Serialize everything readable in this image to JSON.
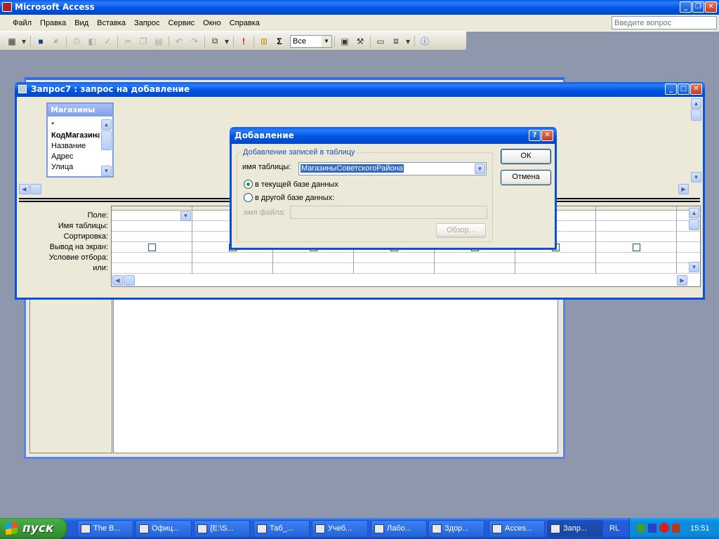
{
  "app": {
    "title": "Microsoft Access",
    "menu": [
      "Файл",
      "Правка",
      "Вид",
      "Вставка",
      "Запрос",
      "Сервис",
      "Окно",
      "Справка"
    ],
    "help_search_placeholder": "Введите вопрос",
    "toolbar_combo_value": "Все"
  },
  "query_window": {
    "title": "Запрос7 : запрос на добавление",
    "table": {
      "name": "Магазины",
      "fields": [
        "*",
        "КодМагазина",
        "Название",
        "Адрес",
        "Улица"
      ]
    },
    "grid_labels": [
      "Поле:",
      "Имя таблицы:",
      "Сортировка:",
      "Вывод на экран:",
      "Условие отбора:",
      "или:"
    ]
  },
  "dialog": {
    "title": "Добавление",
    "group_label": "Добавление записей в таблицу",
    "table_name_label": "имя таблицы:",
    "table_name_value": "МагазиныСоветскогоРайона",
    "radio_current": "в текущей базе данных",
    "radio_other": "в другой базе данных:",
    "file_name_label": "имя файла:",
    "browse_label": "Обзор...",
    "ok_label": "ОК",
    "cancel_label": "Отмена"
  },
  "taskbar": {
    "start_label": "пуск",
    "items": [
      "The B...",
      "Офиц...",
      "{E:\\S...",
      "Таб_...",
      "Учеб...",
      "Лабо...",
      "Здор...",
      "Acces...",
      "Запр..."
    ],
    "lang": "RL",
    "clock": "15:51"
  },
  "colors": {
    "xp_blue": "#0054e3",
    "face": "#ece9d8",
    "desktop": "#8e97ab",
    "start_green": "#3c9a3c"
  }
}
